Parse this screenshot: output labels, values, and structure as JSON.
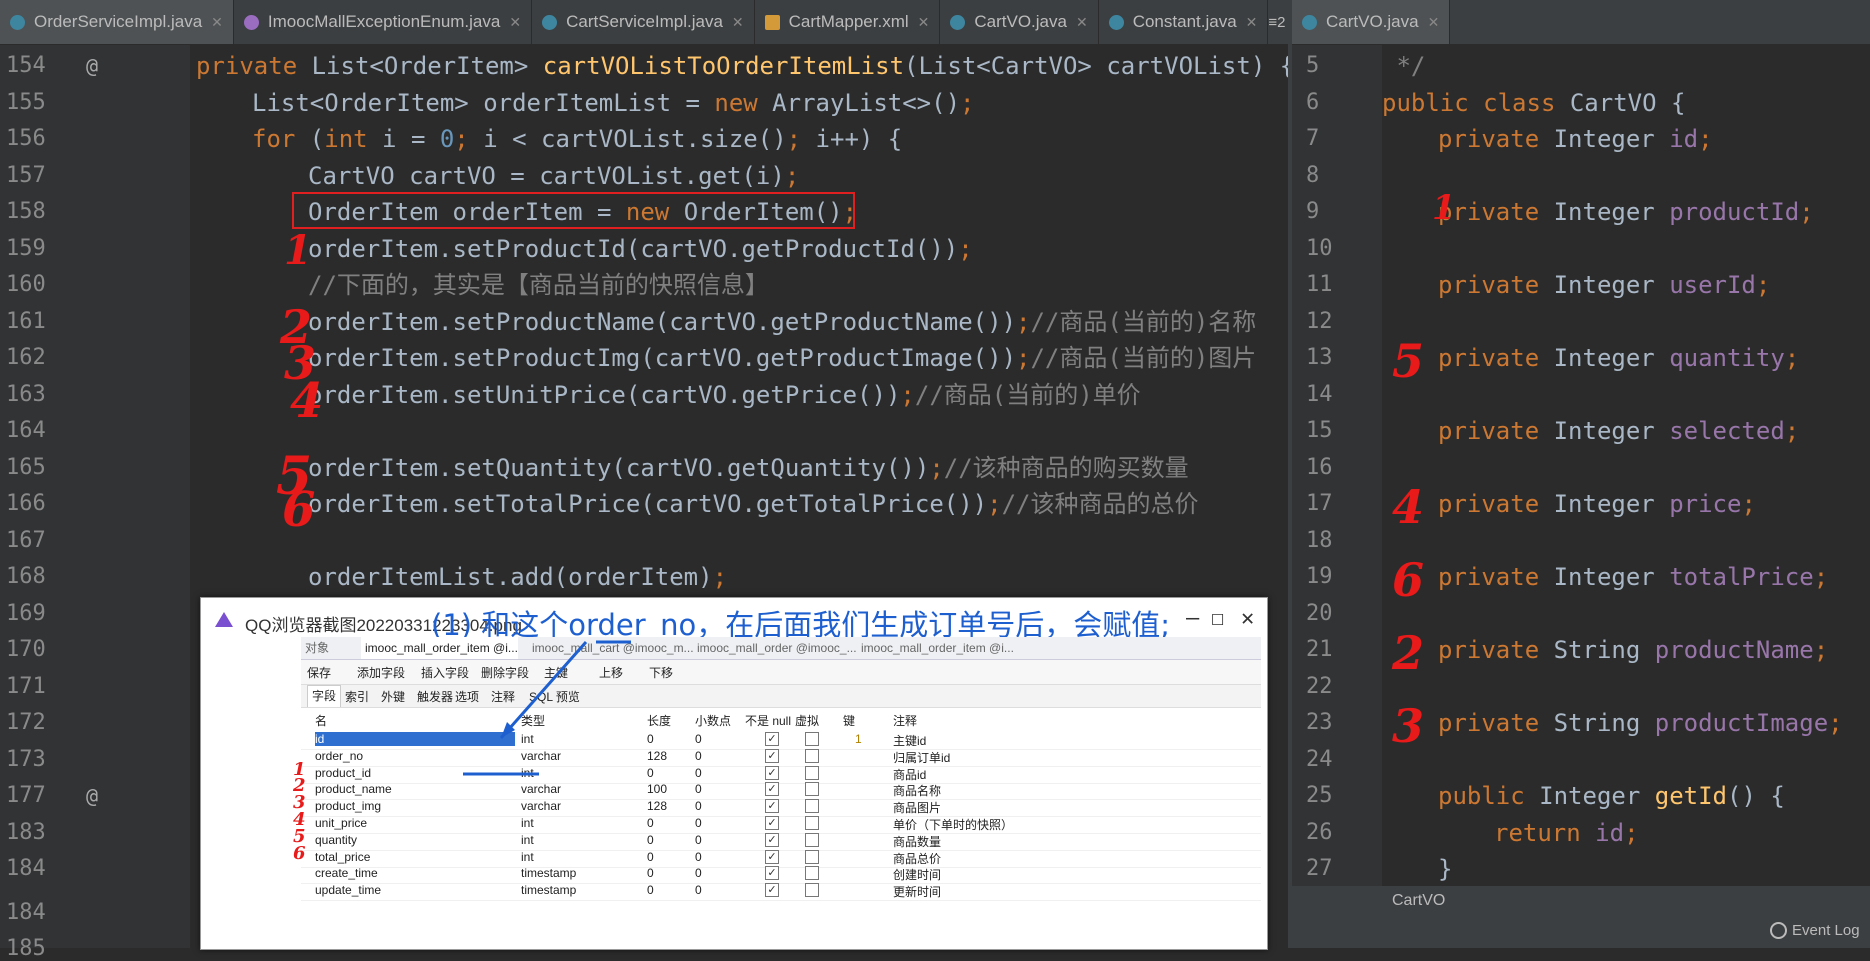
{
  "left_tabs": [
    {
      "label": "OrderServiceImpl.java",
      "kind": "class",
      "active": true
    },
    {
      "label": "ImoocMallExceptionEnum.java",
      "kind": "enum",
      "active": false
    },
    {
      "label": "CartServiceImpl.java",
      "kind": "class",
      "active": false
    },
    {
      "label": "CartMapper.xml",
      "kind": "xml",
      "active": false
    },
    {
      "label": "CartVO.java",
      "kind": "class",
      "active": false
    },
    {
      "label": "Constant.java",
      "kind": "class",
      "active": false
    }
  ],
  "left_tabs_overflow": "≡2",
  "right_tabs": [
    {
      "label": "CartVO.java",
      "kind": "class",
      "active": true
    }
  ],
  "left_code": [
    {
      "n": "154",
      "segs": [
        [
          "kw",
          "private "
        ],
        [
          "typ",
          "List<OrderItem> "
        ],
        [
          "fn",
          "cartVOListToOrderItemList"
        ],
        [
          "typ",
          "(List<"
        ],
        [
          "typ",
          "CartVO"
        ],
        [
          "typ",
          "> cartVOList) {"
        ]
      ],
      "indent": 0
    },
    {
      "n": "155",
      "segs": [
        [
          "typ",
          "List<OrderItem> orderItemList = "
        ],
        [
          "kw",
          "new "
        ],
        [
          "typ",
          "ArrayList<>()"
        ],
        [
          "kw",
          ";"
        ]
      ],
      "indent": 1
    },
    {
      "n": "156",
      "segs": [
        [
          "kw",
          "for "
        ],
        [
          "typ",
          "("
        ],
        [
          "kw",
          "int "
        ],
        [
          "typ",
          "i = "
        ],
        [
          "num",
          "0"
        ],
        [
          "kw",
          "; "
        ],
        [
          "typ",
          "i < cartVOList.size()"
        ],
        [
          "kw",
          "; "
        ],
        [
          "typ",
          "i++) {"
        ]
      ],
      "indent": 1
    },
    {
      "n": "157",
      "segs": [
        [
          "typ",
          "CartVO cartVO = cartVOList.get(i)"
        ],
        [
          "kw",
          ";"
        ]
      ],
      "indent": 2
    },
    {
      "n": "158",
      "segs": [
        [
          "typ",
          "OrderItem orderItem = "
        ],
        [
          "kw",
          "new "
        ],
        [
          "typ",
          "OrderItem()"
        ],
        [
          "kw",
          ";"
        ]
      ],
      "indent": 2
    },
    {
      "n": "159",
      "segs": [
        [
          "typ",
          "orderItem.setProductId(cartVO.getProductId())"
        ],
        [
          "kw",
          ";"
        ]
      ],
      "indent": 2
    },
    {
      "n": "160",
      "segs": [
        [
          "cmt",
          "//下面的，其实是【商品当前的快照信息】"
        ]
      ],
      "indent": 2
    },
    {
      "n": "161",
      "segs": [
        [
          "typ",
          "orderItem.setProductName(cartVO.getProductName())"
        ],
        [
          "kw",
          ";"
        ],
        [
          "cmt",
          "//商品(当前的)名称"
        ]
      ],
      "indent": 2
    },
    {
      "n": "162",
      "segs": [
        [
          "typ",
          "orderItem.setProductImg(cartVO.getProductImage())"
        ],
        [
          "kw",
          ";"
        ],
        [
          "cmt",
          "//商品(当前的)图片"
        ]
      ],
      "indent": 2
    },
    {
      "n": "163",
      "segs": [
        [
          "typ",
          "orderItem.setUnitPrice(cartVO.getPrice())"
        ],
        [
          "kw",
          ";"
        ],
        [
          "cmt",
          "//商品(当前的)单价"
        ]
      ],
      "indent": 2
    },
    {
      "n": "164",
      "segs": [],
      "indent": 2
    },
    {
      "n": "165",
      "segs": [
        [
          "typ",
          "orderItem.setQuantity(cartVO.getQuantity())"
        ],
        [
          "kw",
          ";"
        ],
        [
          "cmt",
          "//该种商品的购买数量"
        ]
      ],
      "indent": 2
    },
    {
      "n": "166",
      "segs": [
        [
          "typ",
          "orderItem.setTotalPrice(cartVO.getTotalPrice())"
        ],
        [
          "kw",
          ";"
        ],
        [
          "cmt",
          "//该种商品的总价"
        ]
      ],
      "indent": 2
    },
    {
      "n": "167",
      "segs": [],
      "indent": 2
    },
    {
      "n": "168",
      "segs": [
        [
          "typ",
          "orderItemList.add(orderItem)"
        ],
        [
          "kw",
          ";"
        ]
      ],
      "indent": 2
    },
    {
      "n": "169",
      "segs": [],
      "indent": 1
    },
    {
      "n": "170",
      "segs": [],
      "indent": 1
    },
    {
      "n": "171",
      "segs": [],
      "indent": 1
    },
    {
      "n": "172",
      "segs": [],
      "indent": 1
    },
    {
      "n": "173",
      "segs": [],
      "indent": 1
    },
    {
      "n": "177",
      "segs": [],
      "indent": 1
    },
    {
      "n": "183",
      "segs": [],
      "indent": 1
    },
    {
      "n": "184",
      "segs": [],
      "indent": 1
    }
  ],
  "left_bottom_lines": [
    "184",
    "185"
  ],
  "right_code": [
    {
      "n": "5",
      "segs": [
        [
          "cmt",
          " */"
        ]
      ],
      "indent": 0
    },
    {
      "n": "6",
      "segs": [
        [
          "kw",
          "public class "
        ],
        [
          "typ",
          "CartVO {"
        ]
      ],
      "indent": 0
    },
    {
      "n": "7",
      "segs": [
        [
          "kw",
          "private "
        ],
        [
          "typ",
          "Integer "
        ],
        [
          "fld",
          "id"
        ],
        [
          "kw",
          ";"
        ]
      ],
      "indent": 1
    },
    {
      "n": "8",
      "segs": [],
      "indent": 1
    },
    {
      "n": "9",
      "segs": [
        [
          "kw",
          "private "
        ],
        [
          "typ",
          "Integer "
        ],
        [
          "fld",
          "productId"
        ],
        [
          "kw",
          ";"
        ]
      ],
      "indent": 1
    },
    {
      "n": "10",
      "segs": [],
      "indent": 1
    },
    {
      "n": "11",
      "segs": [
        [
          "kw",
          "private "
        ],
        [
          "typ",
          "Integer "
        ],
        [
          "fld",
          "userId"
        ],
        [
          "kw",
          ";"
        ]
      ],
      "indent": 1
    },
    {
      "n": "12",
      "segs": [],
      "indent": 1
    },
    {
      "n": "13",
      "segs": [
        [
          "kw",
          "private "
        ],
        [
          "typ",
          "Integer "
        ],
        [
          "fld",
          "quantity"
        ],
        [
          "kw",
          ";"
        ]
      ],
      "indent": 1
    },
    {
      "n": "14",
      "segs": [],
      "indent": 1
    },
    {
      "n": "15",
      "segs": [
        [
          "kw",
          "private "
        ],
        [
          "typ",
          "Integer "
        ],
        [
          "fld",
          "selected"
        ],
        [
          "kw",
          ";"
        ]
      ],
      "indent": 1
    },
    {
      "n": "16",
      "segs": [],
      "indent": 1
    },
    {
      "n": "17",
      "segs": [
        [
          "kw",
          "private "
        ],
        [
          "typ",
          "Integer "
        ],
        [
          "fld",
          "price"
        ],
        [
          "kw",
          ";"
        ]
      ],
      "indent": 1
    },
    {
      "n": "18",
      "segs": [],
      "indent": 1
    },
    {
      "n": "19",
      "segs": [
        [
          "kw",
          "private "
        ],
        [
          "typ",
          "Integer "
        ],
        [
          "fld",
          "totalPrice"
        ],
        [
          "kw",
          ";"
        ]
      ],
      "indent": 1
    },
    {
      "n": "20",
      "segs": [],
      "indent": 1
    },
    {
      "n": "21",
      "segs": [
        [
          "kw",
          "private "
        ],
        [
          "typ",
          "String "
        ],
        [
          "fld",
          "productName"
        ],
        [
          "kw",
          ";"
        ]
      ],
      "indent": 1
    },
    {
      "n": "22",
      "segs": [],
      "indent": 1
    },
    {
      "n": "23",
      "segs": [
        [
          "kw",
          "private "
        ],
        [
          "typ",
          "String "
        ],
        [
          "fld",
          "productImage"
        ],
        [
          "kw",
          ";"
        ]
      ],
      "indent": 1
    },
    {
      "n": "24",
      "segs": [],
      "indent": 1
    },
    {
      "n": "25",
      "segs": [
        [
          "kw",
          "public "
        ],
        [
          "typ",
          "Integer "
        ],
        [
          "fn",
          "getId"
        ],
        [
          "typ",
          "() {"
        ]
      ],
      "indent": 1
    },
    {
      "n": "26",
      "segs": [
        [
          "kw",
          "return "
        ],
        [
          "fld",
          "id"
        ],
        [
          "kw",
          ";"
        ]
      ],
      "indent": 2
    },
    {
      "n": "27",
      "segs": [
        [
          "typ",
          "}"
        ]
      ],
      "indent": 1
    }
  ],
  "right_breadcrumb": "CartVO",
  "status": {
    "event_log": "Event Log"
  },
  "annotations_left": [
    "1",
    "2",
    "3",
    "4",
    "5",
    "6"
  ],
  "annotations_right": [
    "1",
    "5",
    "4",
    "6",
    "2",
    "3"
  ],
  "overlay": {
    "title": "QQ浏览器截图20220331223304.png",
    "blue_note": "(1) 和这个order_no，在后面我们生成订单号后，会赋值;",
    "navicat_tabs": [
      "对象",
      "imooc_mall_order_item @i...",
      "imooc_mall_cart @imooc_m...",
      "imooc_mall_order @imooc_...",
      "imooc_mall_order_item @i..."
    ],
    "toolbar": [
      "保存",
      "添加字段",
      "插入字段",
      "删除字段",
      "主键",
      "上移",
      "下移"
    ],
    "subtabs": [
      "字段",
      "索引",
      "外键",
      "触发器",
      "选项",
      "注释",
      "SQL 预览"
    ],
    "headers": [
      "名",
      "类型",
      "长度",
      "小数点",
      "不是 null",
      "虚拟",
      "键",
      "注释"
    ],
    "rows": [
      {
        "name": "id",
        "type": "int",
        "len": "0",
        "dec": "0",
        "notnull": true,
        "virtual": false,
        "key": "1",
        "comment": "主键id",
        "selected": true
      },
      {
        "name": "order_no",
        "type": "varchar",
        "len": "128",
        "dec": "0",
        "notnull": true,
        "virtual": false,
        "key": "",
        "comment": "归属订单id"
      },
      {
        "name": "product_id",
        "type": "int",
        "len": "0",
        "dec": "0",
        "notnull": true,
        "virtual": false,
        "key": "",
        "comment": "商品id"
      },
      {
        "name": "product_name",
        "type": "varchar",
        "len": "100",
        "dec": "0",
        "notnull": true,
        "virtual": false,
        "key": "",
        "comment": "商品名称"
      },
      {
        "name": "product_img",
        "type": "varchar",
        "len": "128",
        "dec": "0",
        "notnull": true,
        "virtual": false,
        "key": "",
        "comment": "商品图片"
      },
      {
        "name": "unit_price",
        "type": "int",
        "len": "0",
        "dec": "0",
        "notnull": true,
        "virtual": false,
        "key": "",
        "comment": "单价（下单时的快照）"
      },
      {
        "name": "quantity",
        "type": "int",
        "len": "0",
        "dec": "0",
        "notnull": true,
        "virtual": false,
        "key": "",
        "comment": "商品数量"
      },
      {
        "name": "total_price",
        "type": "int",
        "len": "0",
        "dec": "0",
        "notnull": true,
        "virtual": false,
        "key": "",
        "comment": "商品总价"
      },
      {
        "name": "create_time",
        "type": "timestamp",
        "len": "0",
        "dec": "0",
        "notnull": true,
        "virtual": false,
        "key": "",
        "comment": "创建时间"
      },
      {
        "name": "update_time",
        "type": "timestamp",
        "len": "0",
        "dec": "0",
        "notnull": true,
        "virtual": false,
        "key": "",
        "comment": "更新时间"
      }
    ],
    "row_annotations": [
      "1",
      "2",
      "3",
      "4",
      "5",
      "6"
    ]
  },
  "colors": {
    "keyword": "#cc7832",
    "method": "#ffc66d",
    "field": "#9876aa",
    "number": "#6897bb",
    "comment": "#808080",
    "text": "#a9b7c6",
    "annotation_red": "#e81a1a",
    "note_blue": "#1e5fd0"
  }
}
